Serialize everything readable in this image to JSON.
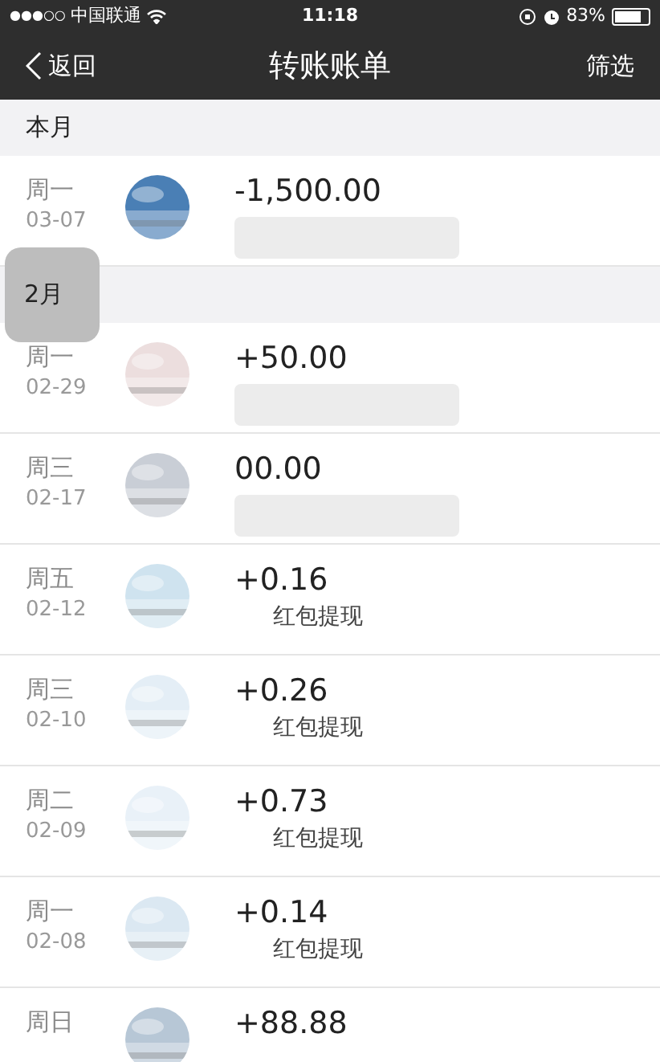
{
  "status_bar": {
    "signal": "●●●○○",
    "carrier": "中国联通",
    "time": "11:18",
    "battery": "83%"
  },
  "nav": {
    "back": "返回",
    "title": "转账账单",
    "action": "筛选"
  },
  "index_popup": "2月",
  "sections": [
    {
      "header": "本月",
      "rows": [
        {
          "day": "周一",
          "date": "03-07",
          "amount": "-1,500.00"
        }
      ]
    },
    {
      "rows": [
        {
          "day": "周一",
          "date": "02-29",
          "amount": "+50.00"
        },
        {
          "day": "周三",
          "date": "02-17",
          "amount": "00.00"
        },
        {
          "day": "周五",
          "date": "02-12",
          "amount": "+0.16",
          "note": "红包提现"
        },
        {
          "day": "周三",
          "date": "02-10",
          "amount": "+0.26",
          "note": "红包提现"
        },
        {
          "day": "周二",
          "date": "02-09",
          "amount": "+0.73",
          "note": "红包提现"
        },
        {
          "day": "周一",
          "date": "02-08",
          "amount": "+0.14",
          "note": "红包提现"
        },
        {
          "day": "周日",
          "amount": "+88.88"
        }
      ]
    }
  ]
}
